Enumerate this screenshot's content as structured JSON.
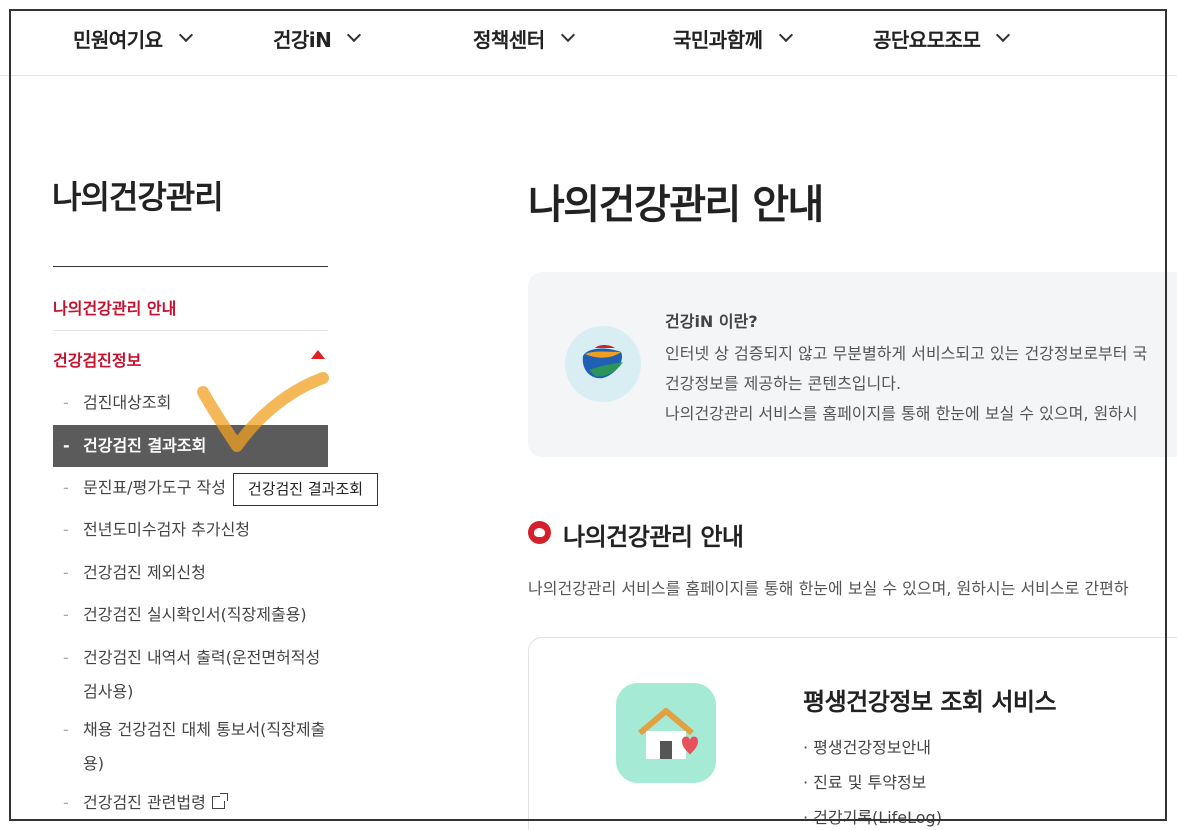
{
  "topnav": {
    "items": [
      {
        "label": "민원여기요"
      },
      {
        "label": "건강iN"
      },
      {
        "label": "정책센터"
      },
      {
        "label": "국민과함께"
      },
      {
        "label": "공단요모조모"
      }
    ]
  },
  "sidebar": {
    "title": "나의건강관리",
    "top_item": "나의건강관리 안내",
    "section": "건강검진정보",
    "sub_items": [
      "검진대상조회",
      "건강검진 결과조회",
      "문진표/평가도구 작성",
      "전년도미수검자 추가신청",
      "건강검진 제외신청",
      "건강검진 실시확인서(직장제출용)",
      "건강검진 내역서 출력(운전면허적성",
      "검사용)",
      "채용 건강검진 대체 통보서(직장제출",
      "용)",
      "건강검진 관련법령"
    ],
    "active_index": 1,
    "tooltip": "건강검진 결과조회"
  },
  "main": {
    "title": "나의건강관리 안내",
    "info": {
      "heading": "건강iN 이란?",
      "lines": [
        "인터넷 상 검증되지 않고 무분별하게 서비스되고 있는 건강정보로부터 국",
        "건강정보를 제공하는 콘텐츠입니다.",
        "나의건강관리 서비스를 홈페이지를 통해 한눈에 보실 수 있으며, 원하시"
      ]
    },
    "section": {
      "title": "나의건강관리 안내",
      "desc": "나의건강관리 서비스를 홈페이지를 통해 한눈에 보실 수 있으며, 원하시는 서비스로 간편하"
    },
    "card": {
      "title": "평생건강정보 조회 서비스",
      "items": [
        "평생건강정보안내",
        "진료 및 투약정보",
        "건강기록(LifeLog)"
      ]
    }
  },
  "colors": {
    "accent": "#c8102e",
    "active_bg": "#5b5b5b",
    "check": "#f0a020"
  }
}
